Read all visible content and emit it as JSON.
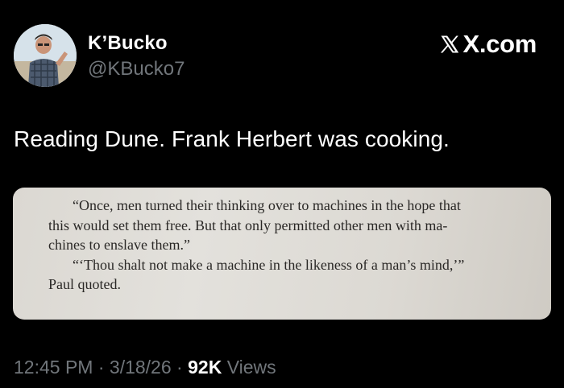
{
  "author": {
    "display_name": "K’Bucko",
    "handle": "@KBucko7",
    "avatar_icon": "profile-photo-avatar"
  },
  "brand": {
    "icon": "x-logo-icon",
    "label": "X.com"
  },
  "tweet": {
    "text": "Reading Dune. Frank Herbert was cooking."
  },
  "media": {
    "book_lines": [
      "“Once, men turned their thinking over to machines in the hope that",
      "this would set them free. But that only permitted other men with ma-",
      "chines to enslave them.”",
      "“‘Thou shalt not make a machine in the likeness of a man’s mind,’”",
      "Paul quoted."
    ]
  },
  "meta": {
    "time": "12:45 PM",
    "date": "3/18/26",
    "views_count": "92K",
    "views_label": "Views",
    "separator": "·"
  },
  "colors": {
    "background": "#000000",
    "primary_text": "#ffffff",
    "secondary_text": "#71767b",
    "page_paper": "#dedbd5"
  }
}
